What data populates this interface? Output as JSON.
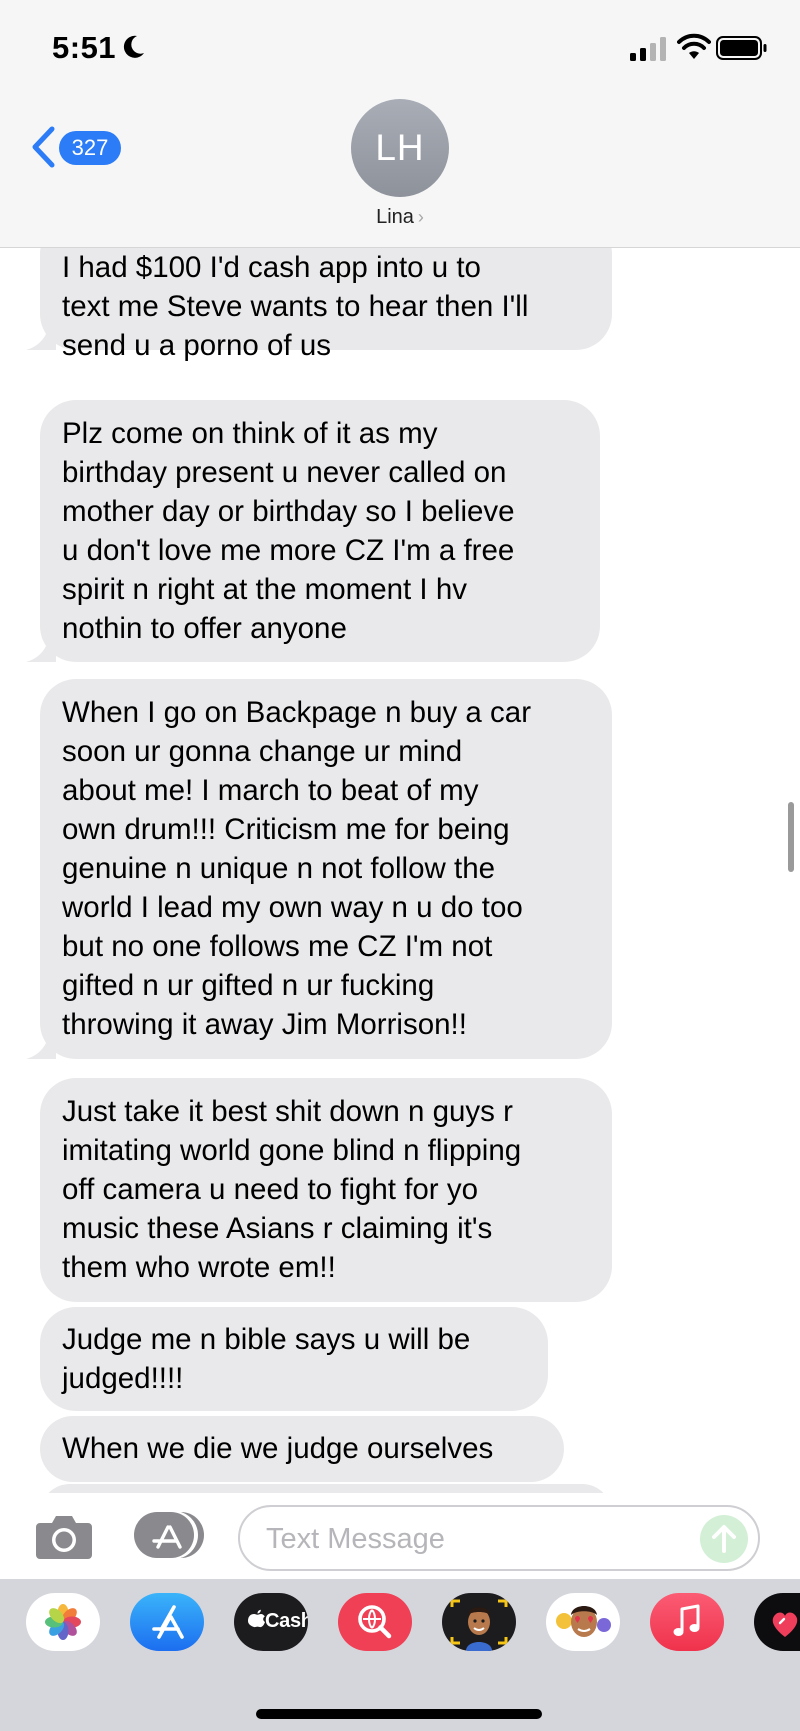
{
  "status_bar": {
    "time": "5:51"
  },
  "header": {
    "back_count": "327",
    "avatar_initials": "LH",
    "contact_name": "Lina",
    "contact_chevron": "›"
  },
  "messages": [
    {
      "lines": [
        "I had $100 I'd cash app into u to",
        "text me Steve wants to hear then I'll",
        "send u a porno of us"
      ]
    },
    {
      "lines": [
        "Plz come on think of it as my",
        "birthday present u never called on",
        "mother day or birthday so I believe",
        "u don't love me more CZ I'm a free",
        "spirit n right at the moment I hv",
        "nothin to offer anyone"
      ]
    },
    {
      "lines": [
        "When I go on Backpage n buy a car",
        "soon ur gonna change ur mind",
        "about me! I march to beat of my",
        "own drum!!! Criticism me for being",
        "genuine n unique n not follow the",
        "world I lead my own way n u do too",
        "but no one follows me CZ I'm not",
        "gifted n ur gifted n ur fucking",
        "throwing it away Jim Morrison!!"
      ]
    },
    {
      "lines": [
        "Just take it best shit down n guys r",
        "imitating world gone blind n flipping",
        "off camera u need to fight for yo",
        "music these Asians r claiming it's",
        "them who wrote em!!"
      ]
    },
    {
      "lines": [
        "Judge me n bible says u will be",
        "judged!!!!"
      ]
    },
    {
      "lines": [
        "When we die we judge ourselves"
      ]
    }
  ],
  "input_bar": {
    "placeholder": "Text Message",
    "value": ""
  },
  "app_drawer": {
    "cash_label": "Cash",
    "icons": [
      "photos-icon",
      "app-store-icon",
      "apple-cash-icon",
      "image-search-icon",
      "memoji-icon",
      "memoji-stickers-icon",
      "music-icon",
      "heart-app-icon"
    ]
  },
  "colors": {
    "accent": "#2b7cf6",
    "bubble": "#e9e9eb",
    "header_bg": "#f6f6f6",
    "drawer_bg": "#d5d6db",
    "send_disabled": "#d3efd6"
  }
}
